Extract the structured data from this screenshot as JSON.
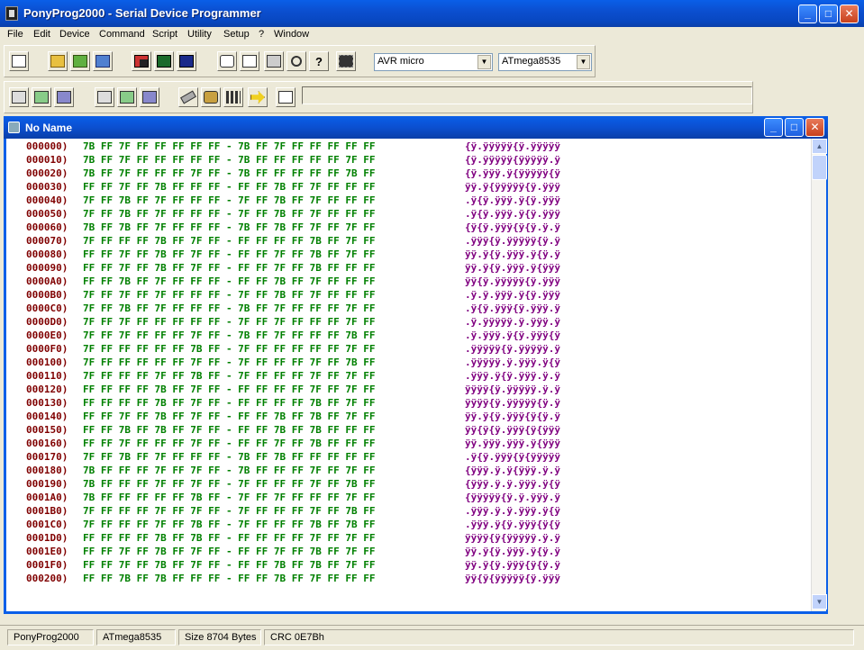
{
  "window": {
    "title": "PonyProg2000 - Serial Device Programmer",
    "minimize": "_",
    "maximize": "□",
    "close": "✕"
  },
  "menu": [
    "File",
    "Edit",
    "Device",
    "Command",
    "Script",
    "Utility",
    "Setup",
    "?",
    "Window"
  ],
  "toolbar": {
    "device_family": "AVR micro",
    "device_model": "ATmega8535",
    "note": ""
  },
  "child": {
    "title": "No Name"
  },
  "hex_rows": [
    {
      "addr": "000000)",
      "hex": "7B FF 7F FF FF FF FF FF - 7B FF 7F FF FF FF FF FF",
      "ascii": "{ÿ.ÿÿÿÿÿ{ÿ.ÿÿÿÿÿ"
    },
    {
      "addr": "000010)",
      "hex": "7B FF 7F FF FF FF FF FF - 7B FF FF FF FF FF 7F FF",
      "ascii": "{ÿ.ÿÿÿÿÿ{ÿÿÿÿÿ.ÿ"
    },
    {
      "addr": "000020)",
      "hex": "7B FF 7F FF FF FF 7F FF - 7B FF FF FF FF FF 7B FF",
      "ascii": "{ÿ.ÿÿÿ.ÿ{ÿÿÿÿÿ{ÿ"
    },
    {
      "addr": "000030)",
      "hex": "FF FF 7F FF 7B FF FF FF - FF FF 7B FF 7F FF FF FF",
      "ascii": "ÿÿ.ÿ{ÿÿÿÿÿ{ÿ.ÿÿÿ"
    },
    {
      "addr": "000040)",
      "hex": "7F FF 7B FF 7F FF FF FF - 7F FF 7B FF 7F FF FF FF",
      "ascii": ".ÿ{ÿ.ÿÿÿ.ÿ{ÿ.ÿÿÿ"
    },
    {
      "addr": "000050)",
      "hex": "7F FF 7B FF 7F FF FF FF - 7F FF 7B FF 7F FF FF FF",
      "ascii": ".ÿ{ÿ.ÿÿÿ.ÿ{ÿ.ÿÿÿ"
    },
    {
      "addr": "000060)",
      "hex": "7B FF 7B FF 7F FF FF FF - 7B FF 7B FF 7F FF 7F FF",
      "ascii": "{ÿ{ÿ.ÿÿÿ{ÿ{ÿ.ÿ.ÿ"
    },
    {
      "addr": "000070)",
      "hex": "7F FF FF FF 7B FF 7F FF - FF FF FF FF 7B FF 7F FF",
      "ascii": ".ÿÿÿ{ÿ.ÿÿÿÿÿ{ÿ.ÿ"
    },
    {
      "addr": "000080)",
      "hex": "FF FF 7F FF 7B FF 7F FF - FF FF 7F FF 7B FF 7F FF",
      "ascii": "ÿÿ.ÿ{ÿ.ÿÿÿ.ÿ{ÿ.ÿ"
    },
    {
      "addr": "000090)",
      "hex": "FF FF 7F FF 7B FF 7F FF - FF FF 7F FF 7B FF FF FF",
      "ascii": "ÿÿ.ÿ{ÿ.ÿÿÿ.ÿ{ÿÿÿ"
    },
    {
      "addr": "0000A0)",
      "hex": "FF FF 7B FF 7F FF FF FF - FF FF 7B FF 7F FF FF FF",
      "ascii": "ÿÿ{ÿ.ÿÿÿÿÿ{ÿ.ÿÿÿ"
    },
    {
      "addr": "0000B0)",
      "hex": "7F FF 7F FF 7F FF FF FF - 7F FF 7B FF 7F FF FF FF",
      "ascii": ".ÿ.ÿ.ÿÿÿ.ÿ{ÿ.ÿÿÿ"
    },
    {
      "addr": "0000C0)",
      "hex": "7F FF 7B FF 7F FF FF FF - 7B FF 7F FF FF FF 7F FF",
      "ascii": ".ÿ{ÿ.ÿÿÿ{ÿ.ÿÿÿ.ÿ"
    },
    {
      "addr": "0000D0)",
      "hex": "7F FF 7F FF FF FF FF FF - 7F FF 7F FF FF FF 7F FF",
      "ascii": ".ÿ.ÿÿÿÿÿ.ÿ.ÿÿÿ.ÿ"
    },
    {
      "addr": "0000E0)",
      "hex": "7F FF 7F FF FF FF 7F FF - 7B FF 7F FF FF FF 7B FF",
      "ascii": ".ÿ.ÿÿÿ.ÿ{ÿ.ÿÿÿ{ÿ"
    },
    {
      "addr": "0000F0)",
      "hex": "7F FF FF FF FF FF 7B FF - 7F FF FF FF FF FF 7F FF",
      "ascii": ".ÿÿÿÿÿ{ÿ.ÿÿÿÿÿ.ÿ"
    },
    {
      "addr": "000100)",
      "hex": "7F FF FF FF FF FF 7F FF - 7F FF FF FF 7F FF 7B FF",
      "ascii": ".ÿÿÿÿÿ.ÿ.ÿÿÿ.ÿ{ÿ"
    },
    {
      "addr": "000110)",
      "hex": "7F FF FF FF 7F FF 7B FF - 7F FF FF FF 7F FF 7F FF",
      "ascii": ".ÿÿÿ.ÿ{ÿ.ÿÿÿ.ÿ.ÿ"
    },
    {
      "addr": "000120)",
      "hex": "FF FF FF FF 7B FF 7F FF - FF FF FF FF 7F FF 7F FF",
      "ascii": "ÿÿÿÿ{ÿ.ÿÿÿÿÿ.ÿ.ÿ"
    },
    {
      "addr": "000130)",
      "hex": "FF FF FF FF 7B FF 7F FF - FF FF FF FF 7B FF 7F FF",
      "ascii": "ÿÿÿÿ{ÿ.ÿÿÿÿÿ{ÿ.ÿ"
    },
    {
      "addr": "000140)",
      "hex": "FF FF 7F FF 7B FF 7F FF - FF FF 7B FF 7B FF 7F FF",
      "ascii": "ÿÿ.ÿ{ÿ.ÿÿÿ{ÿ{ÿ.ÿ"
    },
    {
      "addr": "000150)",
      "hex": "FF FF 7B FF 7B FF 7F FF - FF FF 7B FF 7B FF FF FF",
      "ascii": "ÿÿ{ÿ{ÿ.ÿÿÿ{ÿ{ÿÿÿ"
    },
    {
      "addr": "000160)",
      "hex": "FF FF 7F FF FF FF 7F FF - FF FF 7F FF 7B FF FF FF",
      "ascii": "ÿÿ.ÿÿÿ.ÿÿÿ.ÿ{ÿÿÿ"
    },
    {
      "addr": "000170)",
      "hex": "7F FF 7B FF 7F FF FF FF - 7B FF 7B FF FF FF FF FF",
      "ascii": ".ÿ{ÿ.ÿÿÿ{ÿ{ÿÿÿÿÿ"
    },
    {
      "addr": "000180)",
      "hex": "7B FF FF FF 7F FF 7F FF - 7B FF FF FF 7F FF 7F FF",
      "ascii": "{ÿÿÿ.ÿ.ÿ{ÿÿÿ.ÿ.ÿ"
    },
    {
      "addr": "000190)",
      "hex": "7B FF FF FF 7F FF 7F FF - 7F FF FF FF 7F FF 7B FF",
      "ascii": "{ÿÿÿ.ÿ.ÿ.ÿÿÿ.ÿ{ÿ"
    },
    {
      "addr": "0001A0)",
      "hex": "7B FF FF FF FF FF 7B FF - 7F FF 7F FF FF FF 7F FF",
      "ascii": "{ÿÿÿÿÿ{ÿ.ÿ.ÿÿÿ.ÿ"
    },
    {
      "addr": "0001B0)",
      "hex": "7F FF FF FF 7F FF 7F FF - 7F FF FF FF 7F FF 7B FF",
      "ascii": ".ÿÿÿ.ÿ.ÿ.ÿÿÿ.ÿ{ÿ"
    },
    {
      "addr": "0001C0)",
      "hex": "7F FF FF FF 7F FF 7B FF - 7F FF FF FF 7B FF 7B FF",
      "ascii": ".ÿÿÿ.ÿ{ÿ.ÿÿÿ{ÿ{ÿ"
    },
    {
      "addr": "0001D0)",
      "hex": "FF FF FF FF 7B FF 7B FF - FF FF FF FF 7F FF 7F FF",
      "ascii": "ÿÿÿÿ{ÿ{ÿÿÿÿÿ.ÿ.ÿ"
    },
    {
      "addr": "0001E0)",
      "hex": "FF FF 7F FF 7B FF 7F FF - FF FF 7F FF 7B FF 7F FF",
      "ascii": "ÿÿ.ÿ{ÿ.ÿÿÿ.ÿ{ÿ.ÿ"
    },
    {
      "addr": "0001F0)",
      "hex": "FF FF 7F FF 7B FF 7F FF - FF FF 7B FF 7B FF 7F FF",
      "ascii": "ÿÿ.ÿ{ÿ.ÿÿÿ{ÿ{ÿ.ÿ"
    },
    {
      "addr": "000200)",
      "hex": "FF FF 7B FF 7B FF FF FF - FF FF 7B FF 7F FF FF FF",
      "ascii": "ÿÿ{ÿ{ÿÿÿÿÿ{ÿ.ÿÿÿ"
    }
  ],
  "status": {
    "app": "PonyProg2000",
    "device": "ATmega8535",
    "size": "Size  8704 Bytes",
    "crc": "CRC  0E7Bh"
  },
  "scroll": {
    "up": "▲",
    "down": "▼"
  },
  "colors": {
    "address": "#800000",
    "hex": "#008000",
    "ascii": "#800080",
    "titlebar": "#0A5FE8"
  }
}
